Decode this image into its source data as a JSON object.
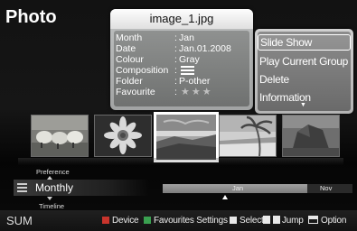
{
  "screen_title": "Photo",
  "info_popup": {
    "title": "image_1.jpg",
    "rows": [
      {
        "label": "Month",
        "sep": ":",
        "value": "Jan"
      },
      {
        "label": "Date",
        "sep": ":",
        "value": "Jan.01.2008"
      },
      {
        "label": "Colour",
        "sep": ":",
        "value": "Gray"
      },
      {
        "label": "Composition",
        "sep": ":",
        "value_icon": "composition-lines-icon"
      },
      {
        "label": "Folder",
        "sep": ":",
        "value": "P-other"
      },
      {
        "label": "Favourite",
        "sep": ":",
        "value": "★★★"
      }
    ]
  },
  "option_menu": {
    "items": [
      "Slide Show",
      "Play Current Group",
      "Delete",
      "Information"
    ],
    "selected_index": 0,
    "more_indicator": "▼"
  },
  "thumbnails": [
    {
      "name": "sheep-photo",
      "selected": false
    },
    {
      "name": "flower-photo",
      "selected": false
    },
    {
      "name": "seascape-photo",
      "selected": true
    },
    {
      "name": "palm-beach-photo",
      "selected": false
    },
    {
      "name": "rock-photo",
      "selected": false
    }
  ],
  "sort": {
    "top_label": "Preference",
    "current": "Monthly",
    "bottom_label": "Timeline"
  },
  "timeline": {
    "months": [
      {
        "label": "Jan"
      },
      {
        "label": "Nov"
      }
    ]
  },
  "footer": {
    "sum_label": "SUM",
    "device_label": "Device",
    "favourites_label": "Favourites Settings",
    "select_label": "Select",
    "jump_label": "Jump",
    "option_label": "Option"
  },
  "colors": {
    "red_button": "#c8342c",
    "green_button": "#3aa050",
    "yellow_button": "#e5cf35",
    "blue_button": "#2e63c9"
  }
}
